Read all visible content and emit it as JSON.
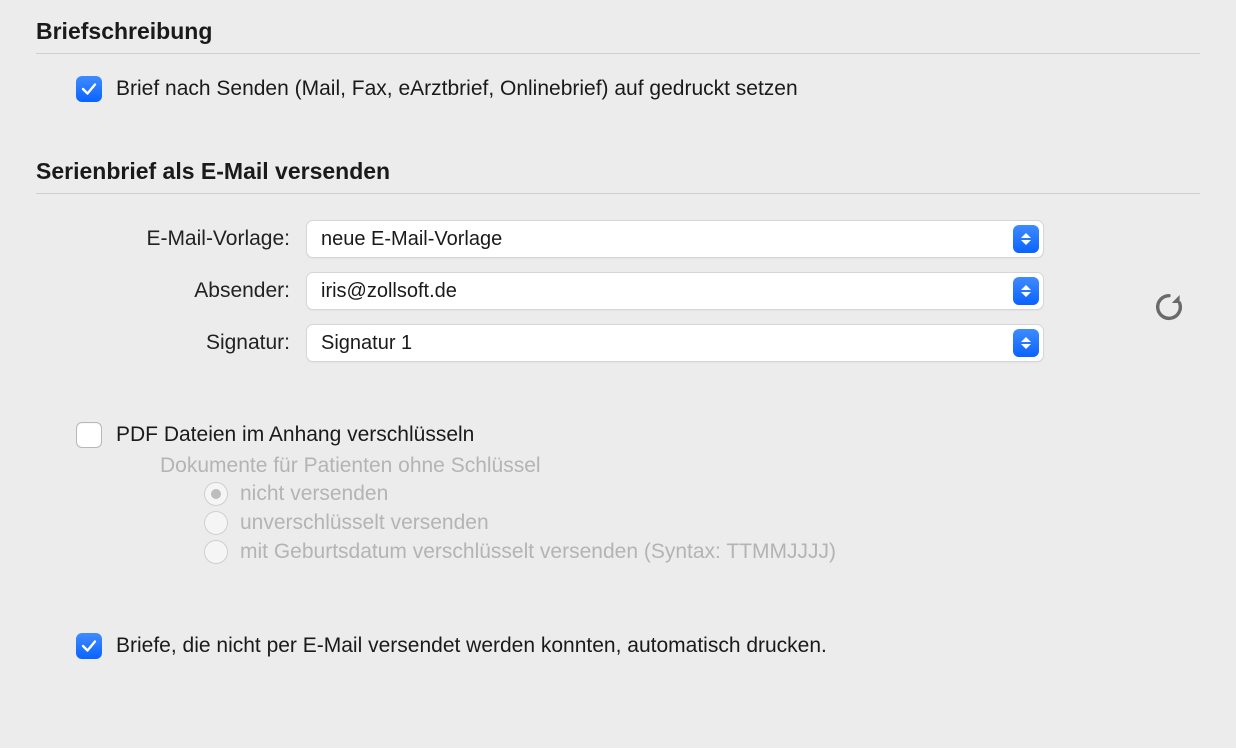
{
  "section1": {
    "heading": "Briefschreibung",
    "check_brief_after_send": {
      "checked": true,
      "label": "Brief nach Senden (Mail, Fax, eArztbrief, Onlinebrief) auf gedruckt setzen"
    }
  },
  "section2": {
    "heading": "Serienbrief als E-Mail versenden",
    "fields": {
      "email_template": {
        "label": "E-Mail-Vorlage:",
        "value": "neue E-Mail-Vorlage"
      },
      "sender": {
        "label": "Absender:",
        "value": "iris@zollsoft.de"
      },
      "signature": {
        "label": "Signatur:",
        "value": "Signatur 1"
      }
    },
    "encrypt_pdf": {
      "checked": false,
      "label": "PDF Dateien im Anhang verschlüsseln",
      "sub_heading": "Dokumente für Patienten ohne Schlüssel",
      "options": [
        {
          "label": "nicht versenden",
          "selected": true
        },
        {
          "label": "unverschlüsselt versenden",
          "selected": false
        },
        {
          "label": "mit Geburtsdatum verschlüsselt versenden (Syntax: TTMMJJJJ)",
          "selected": false
        }
      ]
    },
    "auto_print": {
      "checked": true,
      "label": "Briefe, die nicht per E-Mail versendet werden konnten, automatisch drucken."
    }
  }
}
